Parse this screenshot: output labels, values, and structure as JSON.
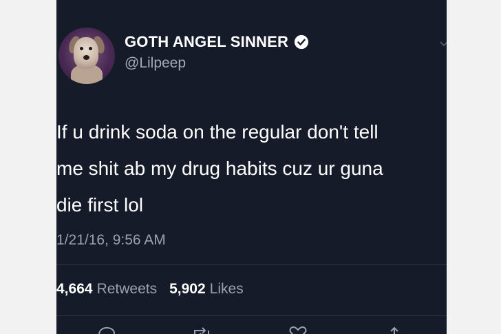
{
  "tweet": {
    "display_name": "GOTH ANGEL SINNER",
    "handle": "@Lilpeep",
    "text_lines": [
      "If u drink soda on the regular don't tell",
      "me shit ab my drug habits cuz ur guna",
      "die first lol"
    ],
    "timestamp": "1/21/16, 9:56 AM",
    "retweets_count": "4,664",
    "retweets_label": "Retweets",
    "likes_count": "5,902",
    "likes_label": "Likes"
  },
  "colors": {
    "background": "#151b28",
    "text": "#ffffff",
    "secondary_text": "#98a2b0",
    "frame_outside": "#f2f2f2"
  },
  "icons": [
    "verified-icon",
    "chevron-down-icon",
    "reply-icon",
    "retweet-icon",
    "like-icon",
    "share-icon"
  ]
}
